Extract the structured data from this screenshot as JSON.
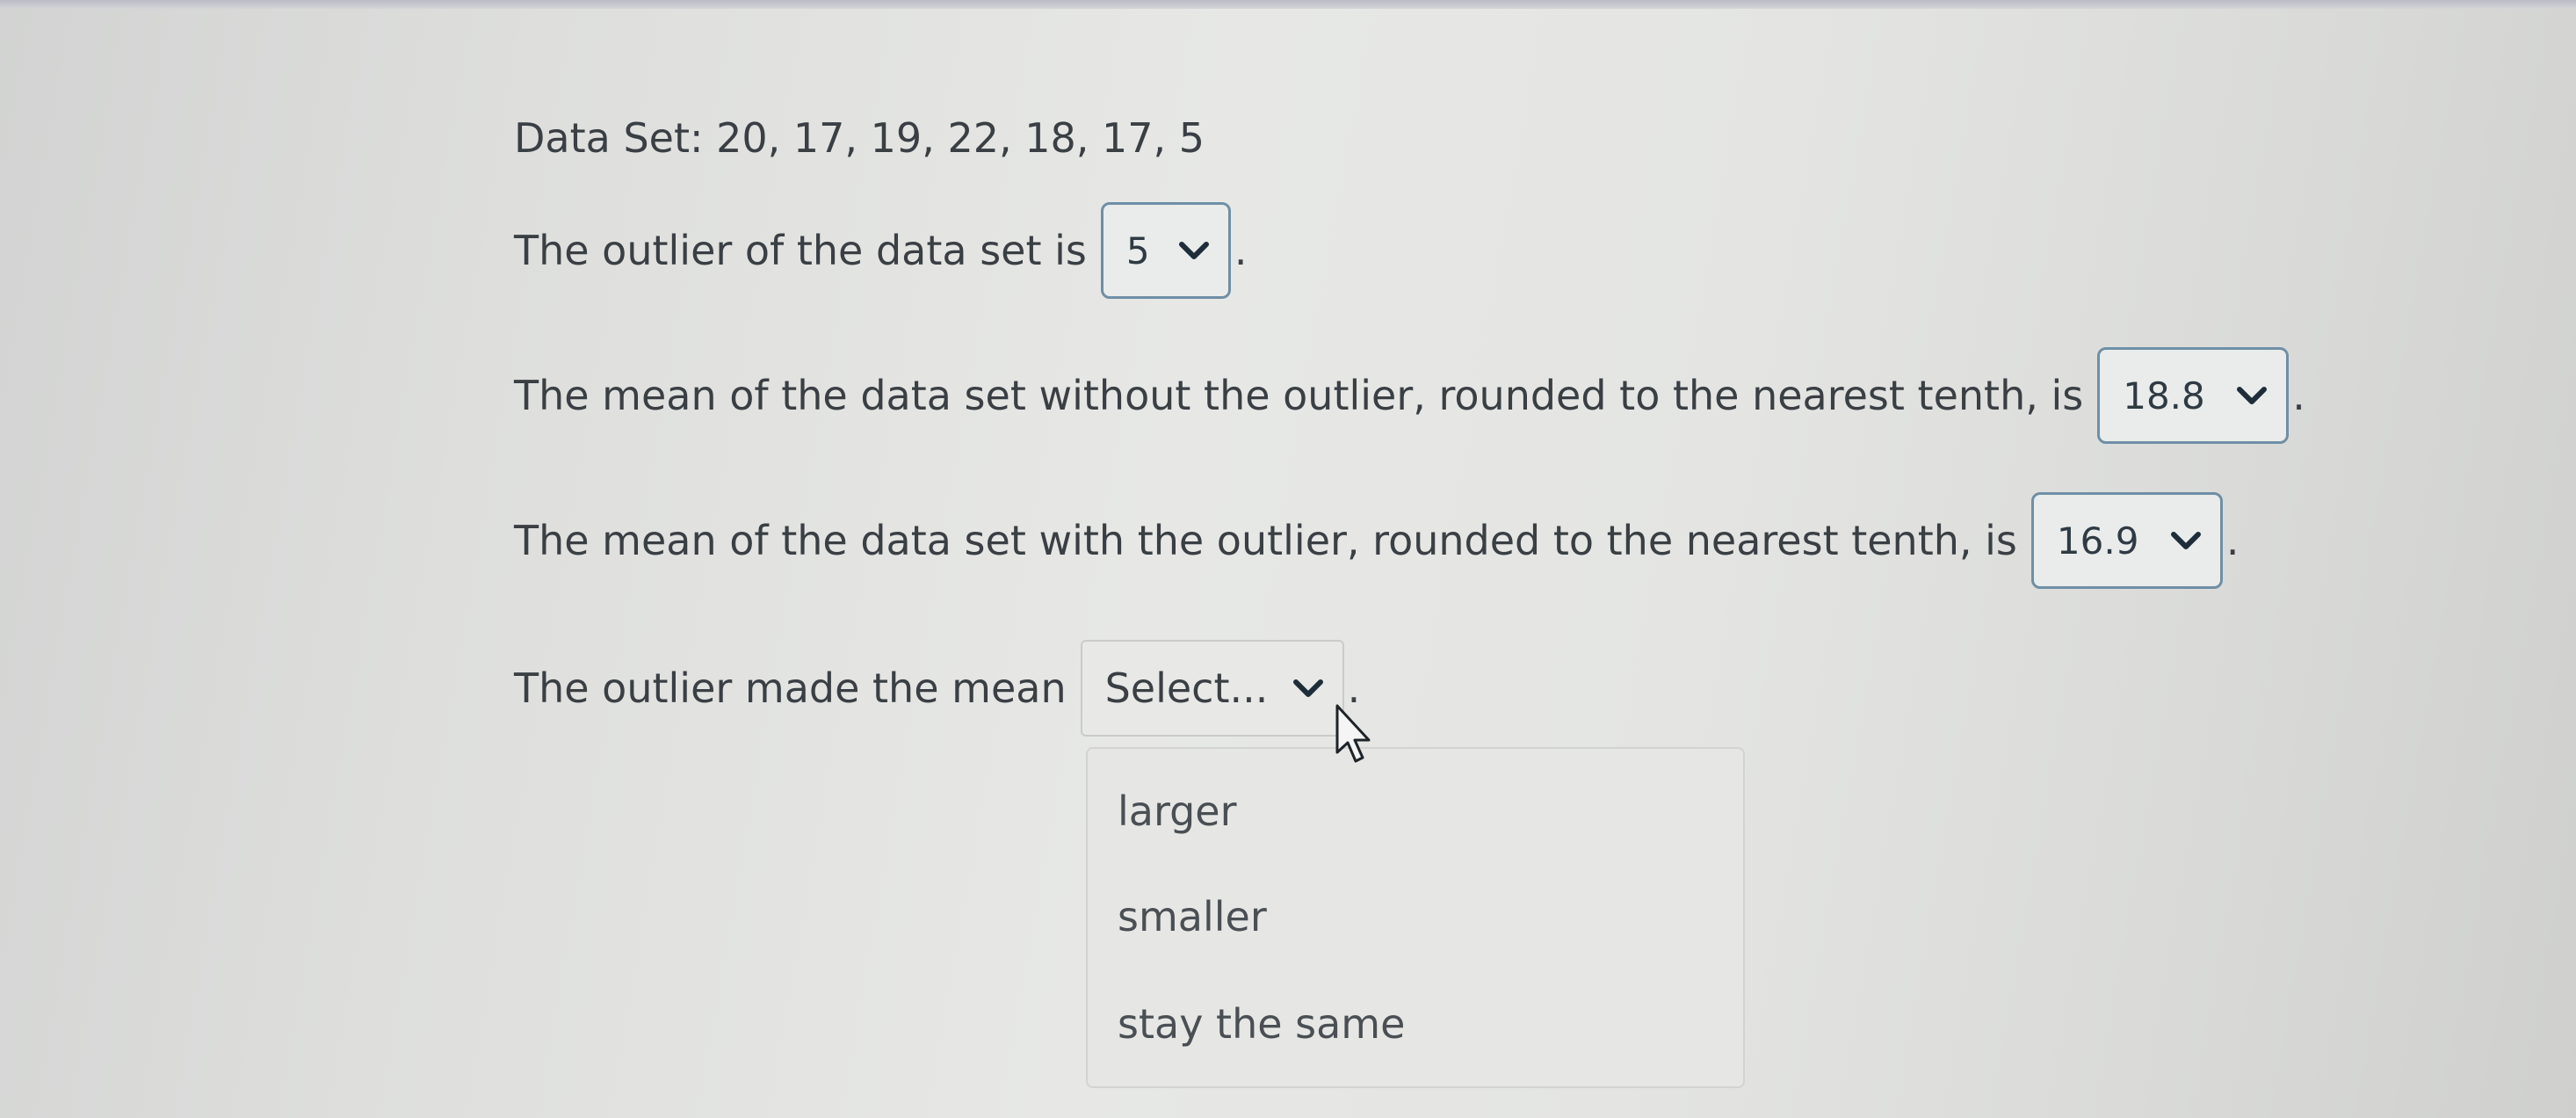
{
  "data_set_text": "Data Set: 20, 17, 19, 22, 18, 17, 5",
  "q1": {
    "prefix": "The outlier of the data set is",
    "value": "5",
    "suffix": "."
  },
  "q2": {
    "prefix": "The mean of the data set without the outlier, rounded to the nearest tenth, is",
    "value": "18.8",
    "suffix": "."
  },
  "q3": {
    "prefix": "The mean of the data set with the outlier, rounded to the nearest tenth, is",
    "value": "16.9",
    "suffix": "."
  },
  "q4": {
    "prefix": "The outlier made the mean",
    "value": "Select...",
    "suffix": "."
  },
  "dropdown_options": [
    "larger",
    "smaller",
    "stay the same"
  ],
  "icons": {
    "chevron": "chevron-down-icon",
    "cursor": "mouse-pointer-icon"
  },
  "colors": {
    "select_border": "#6f8fa6",
    "text": "#3a3f44"
  }
}
